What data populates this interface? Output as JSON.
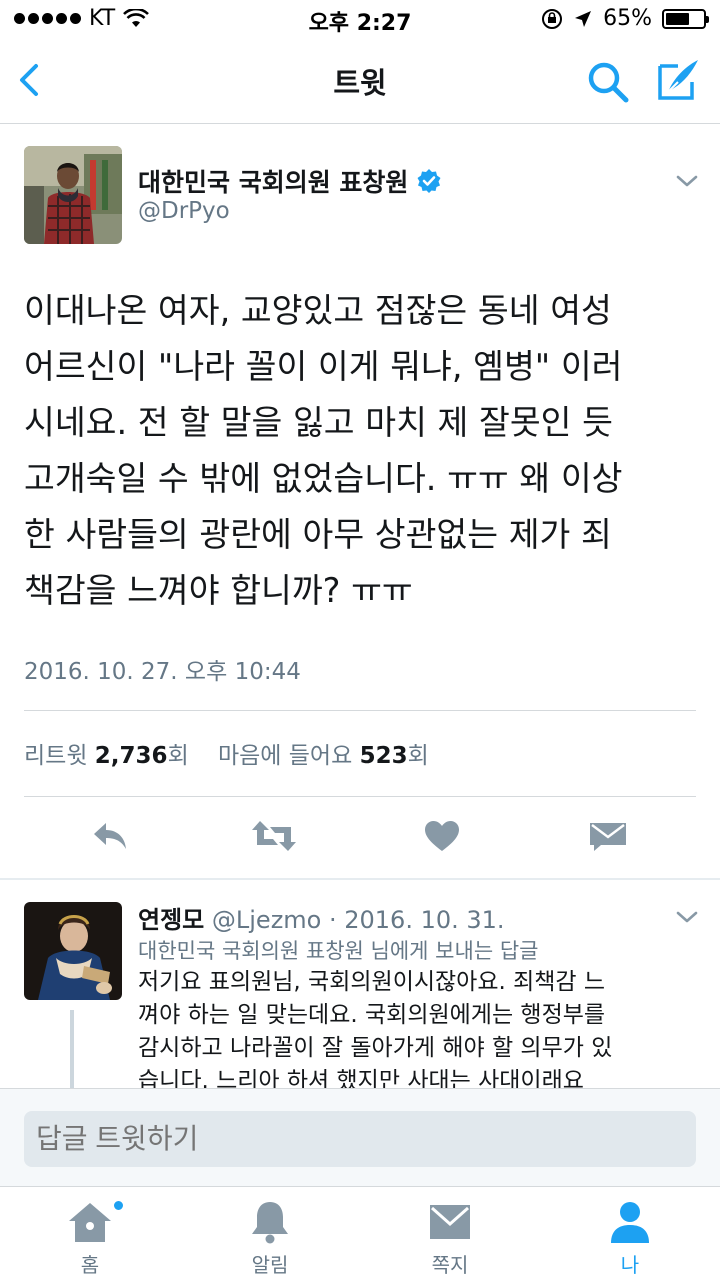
{
  "status_bar": {
    "carrier": "KT",
    "time": "오후 2:27",
    "battery": "65%",
    "battery_level": 0.65
  },
  "nav": {
    "title": "트윗"
  },
  "tweet": {
    "author_name": "대한민국 국회의원 표창원",
    "author_handle": "@DrPyo",
    "text_lines": [
      "이대나온 여자, 교양있고 점잖은 동네 여성",
      "어르신이 \"나라 꼴이 이게 뭐냐, 옘병\" 이러",
      "시네요. 전 할 말을 잃고 마치 제 잘못인 듯",
      "고개숙일 수 밖에 없었습니다. ㅠㅠ 왜 이상",
      "한 사람들의 광란에 아무 상관없는 제가 죄",
      "책감을 느껴야 합니까? ㅠㅠ"
    ],
    "timestamp": "2016. 10. 27. 오후 10:44",
    "retweet_label": "리트윗",
    "retweet_count": "2,736",
    "count_unit": "회",
    "like_label": "마음에 들어요",
    "like_count": "523"
  },
  "reply": {
    "author_name": "연젱모",
    "meta": "@Ljezmo · 2016. 10. 31.",
    "replying_to": "대한민국 국회의원 표창원 님에게 보내는 답글",
    "text_lines": [
      "저기요 표의원님, 국회의원이시잖아요. 죄책감 느",
      "껴야 하는 일 맞는데요. 국회의원에게는 행정부를",
      "감시하고 나라꼴이 잘 돌아가게 해야 할 의무가 있",
      "습니다. 느리아 하셔 했지만 사대는 사대이래요"
    ]
  },
  "compose": {
    "placeholder": "답글 트윗하기"
  },
  "tabs": [
    {
      "label": "홈",
      "icon": "home-icon"
    },
    {
      "label": "알림",
      "icon": "bell-icon"
    },
    {
      "label": "쪽지",
      "icon": "envelope-icon"
    },
    {
      "label": "나",
      "icon": "person-icon"
    }
  ],
  "colors": {
    "accent": "#1da1f2",
    "muted": "#657786",
    "icon_gray": "#8899a6"
  }
}
